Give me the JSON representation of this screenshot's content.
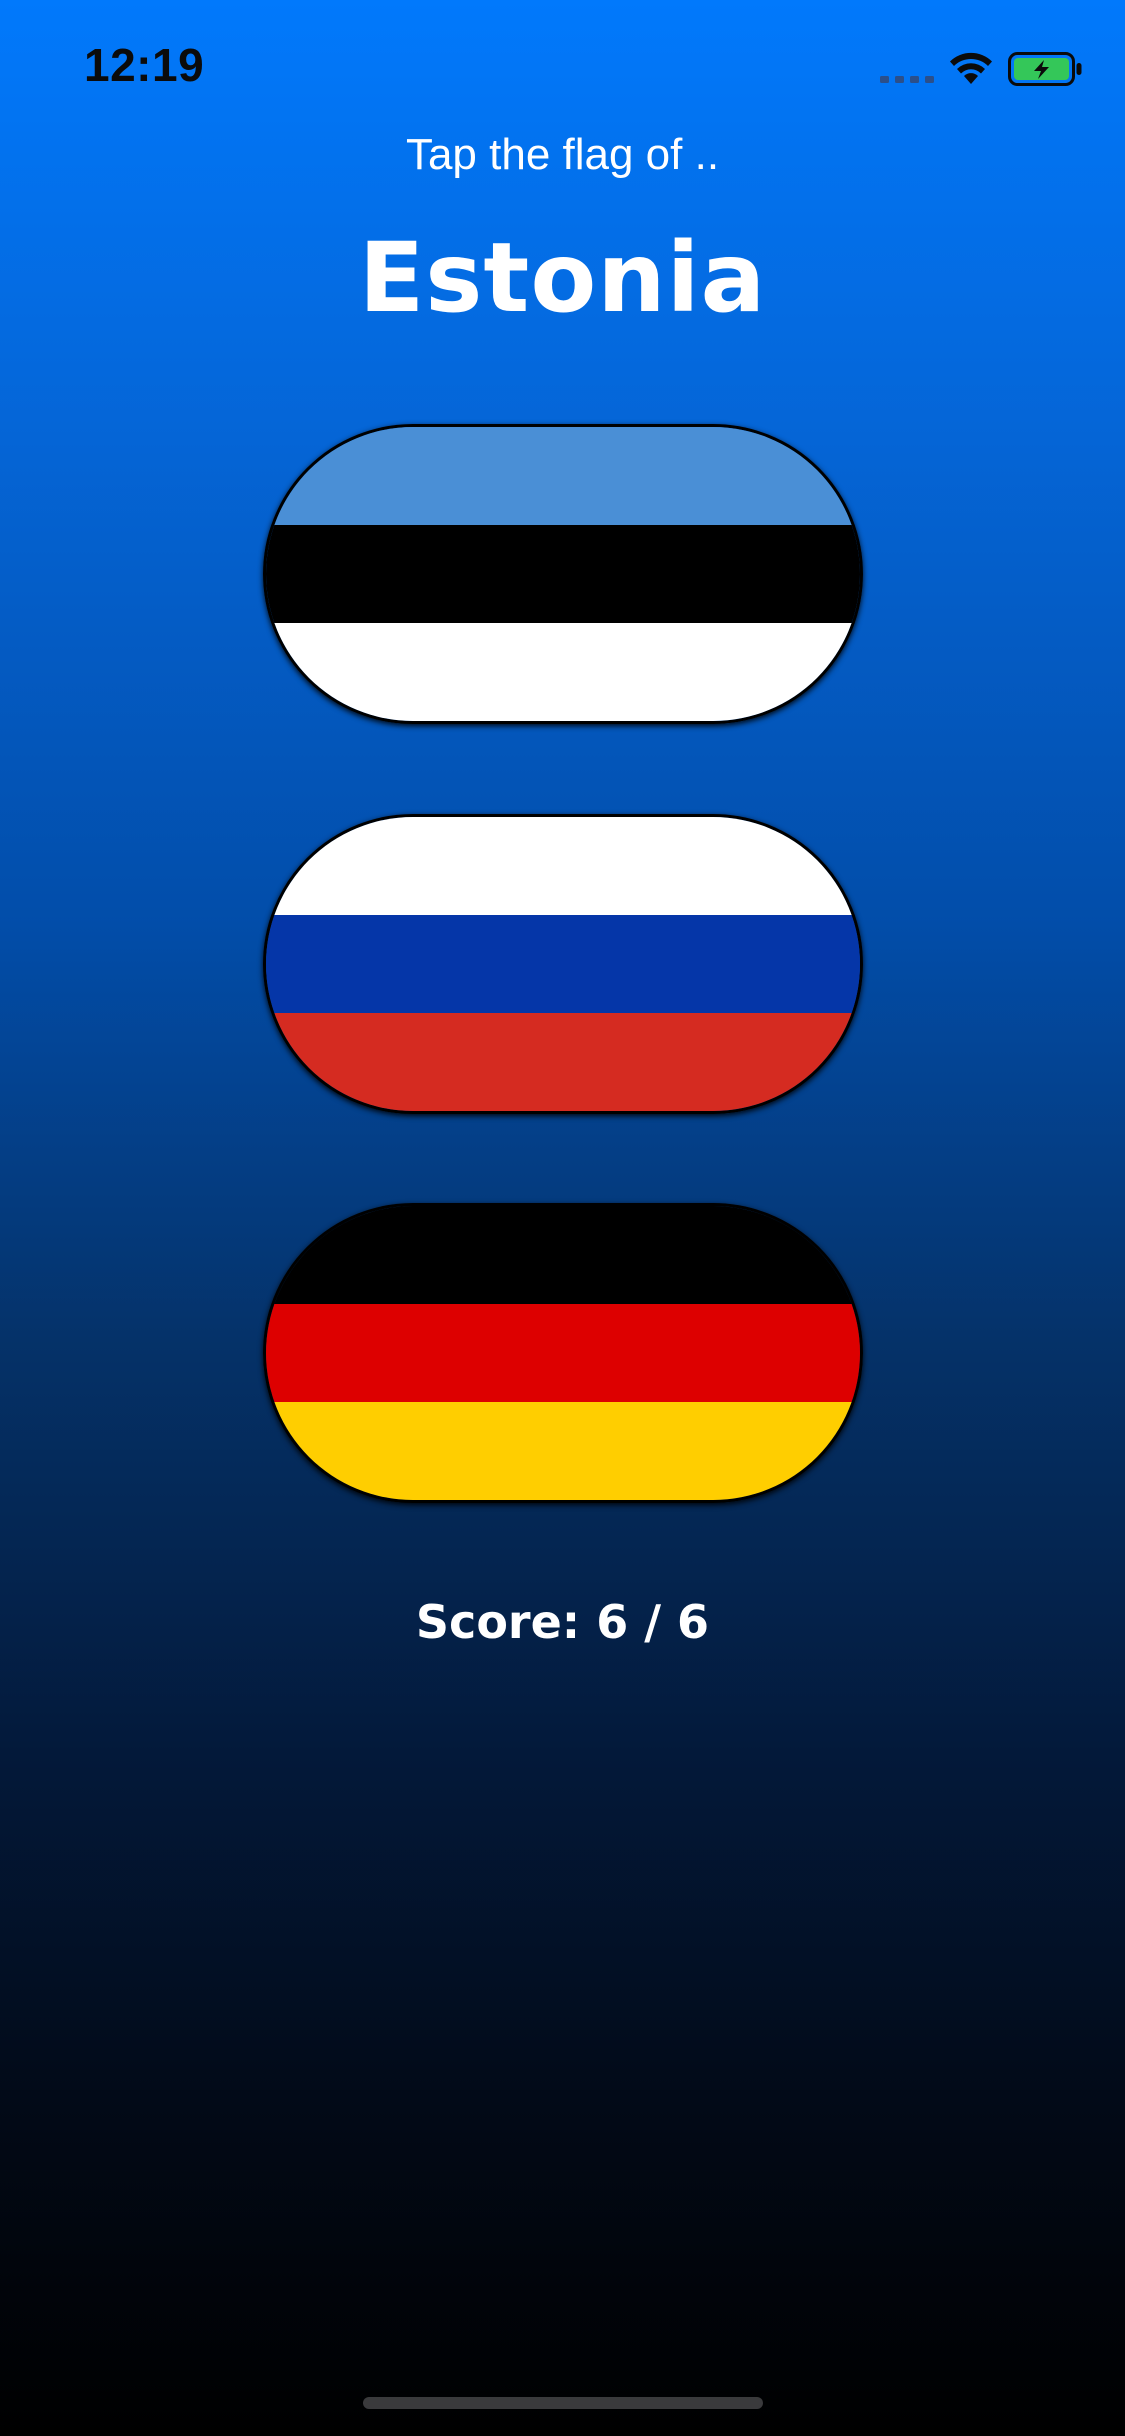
{
  "status_bar": {
    "time": "12:19",
    "icons": [
      "cellular-signal-icon",
      "wifi-icon",
      "battery-charging-icon"
    ]
  },
  "prompt": "Tap the flag of ..",
  "country": "Estonia",
  "flags": [
    {
      "name": "estonia-flag",
      "stripes": [
        "#4a8fd6",
        "#000000",
        "#ffffff"
      ]
    },
    {
      "name": "russia-flag",
      "stripes": [
        "#ffffff",
        "#0536a8",
        "#d52b21"
      ]
    },
    {
      "name": "germany-flag",
      "stripes": [
        "#000000",
        "#dd0000",
        "#ffce00"
      ]
    }
  ],
  "score_text": "Score: 6 / 6",
  "colors": {
    "background_top": "#0179fc",
    "background_bottom": "#000000",
    "battery_fill": "#34c759"
  }
}
